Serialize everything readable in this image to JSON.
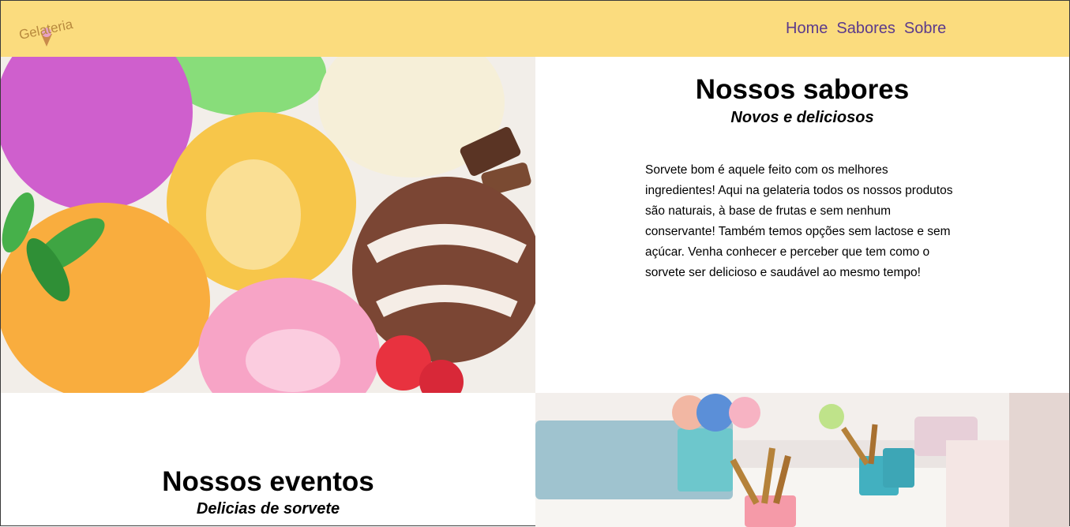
{
  "header": {
    "logo_text": "Gelateria",
    "nav": [
      "Home",
      "Sabores",
      "Sobre"
    ]
  },
  "flavors": {
    "title": "Nossos sabores",
    "subtitle": "Novos e deliciosos",
    "body": "Sorvete bom é aquele feito com os melhores ingredientes! Aqui na gelateria todos os nossos produtos são naturais, à base de frutas e sem nenhum conservante! Também temos opções sem lactose e sem açúcar. Venha conhecer e perceber que tem como o sorvete ser delicioso e saudável ao mesmo tempo!"
  },
  "events": {
    "title": "Nossos eventos",
    "subtitle": "Delicias de sorvete"
  },
  "colors": {
    "header_bg": "#fbdc7e",
    "nav_link": "#5b3a8c"
  }
}
